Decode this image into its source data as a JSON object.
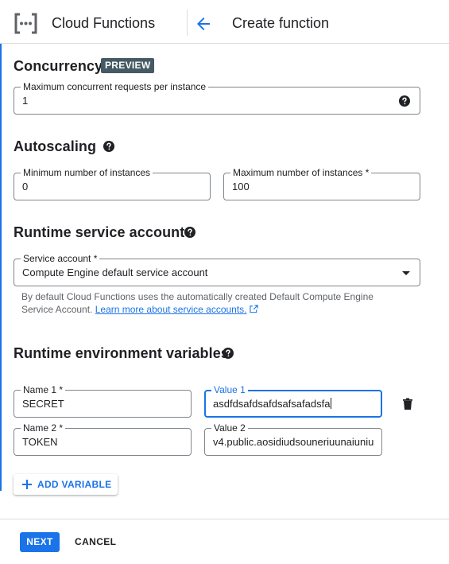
{
  "header": {
    "app_title": "Cloud Functions",
    "page_title": "Create function"
  },
  "concurrency": {
    "title": "Concurrency",
    "badge": "PREVIEW",
    "max_requests_label": "Maximum concurrent requests per instance",
    "max_requests_value": "1"
  },
  "autoscaling": {
    "title": "Autoscaling",
    "min_label": "Minimum number of instances",
    "min_value": "0",
    "max_label": "Maximum number of instances *",
    "max_value": "100"
  },
  "service_account": {
    "title": "Runtime service account",
    "label": "Service account *",
    "value": "Compute Engine default service account",
    "helper_text": "By default Cloud Functions uses the automatically created Default Compute Engine Service Account.",
    "link_text": "Learn more about service accounts."
  },
  "env_vars": {
    "title": "Runtime environment variables",
    "rows": [
      {
        "name_label": "Name 1 *",
        "name_value": "SECRET",
        "value_label": "Value 1",
        "value_value": "asdfdsafdsafdsafsafadsfa"
      },
      {
        "name_label": "Name 2 *",
        "name_value": "TOKEN",
        "value_label": "Value 2",
        "value_value": "v4.public.aosidiudsouneriuunaiuniu"
      }
    ],
    "add_label": "ADD VARIABLE"
  },
  "footer": {
    "next_label": "NEXT",
    "cancel_label": "CANCEL"
  },
  "colors": {
    "accent": "#1a73e8",
    "badge_bg": "#455a64",
    "outline": "#80868b"
  }
}
